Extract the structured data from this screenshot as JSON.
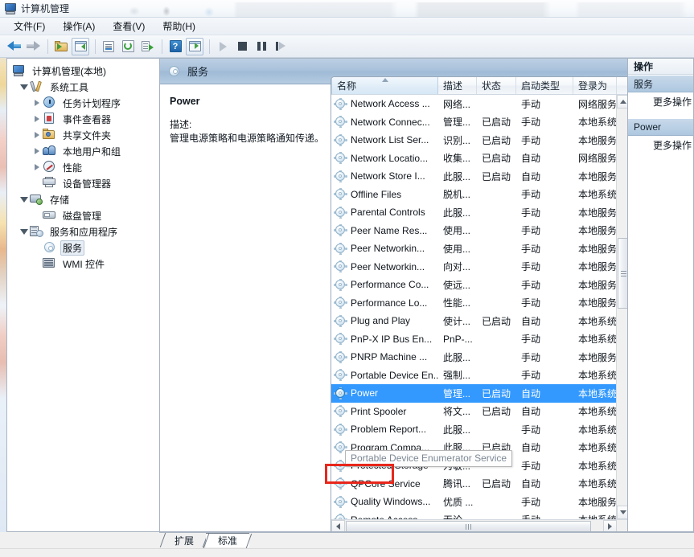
{
  "window": {
    "title": "计算机管理",
    "app_icon": "computer-management-icon"
  },
  "menubar": [
    {
      "label": "文件(F)"
    },
    {
      "label": "操作(A)"
    },
    {
      "label": "查看(V)"
    },
    {
      "label": "帮助(H)"
    }
  ],
  "toolbar": {
    "buttons": [
      {
        "name": "back",
        "icon": "back-arrow-icon"
      },
      {
        "name": "forward",
        "icon": "forward-arrow-icon"
      },
      {
        "name": "up-folder",
        "icon": "folder-up-icon"
      },
      {
        "name": "show-console-tree",
        "icon": "console-tree-icon"
      },
      {
        "name": "properties",
        "icon": "properties-icon"
      },
      {
        "name": "refresh",
        "icon": "refresh-icon"
      },
      {
        "name": "export-list",
        "icon": "export-list-icon"
      },
      {
        "name": "help",
        "icon": "help-icon"
      },
      {
        "name": "show-action-pane",
        "icon": "action-pane-icon"
      },
      {
        "name": "start-service",
        "icon": "play-icon"
      },
      {
        "name": "stop-service",
        "icon": "stop-icon"
      },
      {
        "name": "pause-service",
        "icon": "pause-icon"
      },
      {
        "name": "restart-service",
        "icon": "restart-icon"
      }
    ],
    "help_glyph": "?"
  },
  "tree": {
    "root": {
      "label": "计算机管理(本地)",
      "icon": "computer-icon"
    },
    "items": [
      {
        "label": "系统工具",
        "icon": "tools-icon",
        "indent": 1,
        "expander": "open",
        "selected": false
      },
      {
        "label": "任务计划程序",
        "icon": "clock-icon",
        "indent": 2,
        "expander": "closed",
        "selected": false
      },
      {
        "label": "事件查看器",
        "icon": "event-icon",
        "indent": 2,
        "expander": "closed",
        "selected": false
      },
      {
        "label": "共享文件夹",
        "icon": "share-icon",
        "indent": 2,
        "expander": "closed",
        "selected": false
      },
      {
        "label": "本地用户和组",
        "icon": "users-icon",
        "indent": 2,
        "expander": "closed",
        "selected": false
      },
      {
        "label": "性能",
        "icon": "perf-icon",
        "indent": 2,
        "expander": "closed",
        "selected": false
      },
      {
        "label": "设备管理器",
        "icon": "device-icon",
        "indent": 2,
        "expander": "none",
        "selected": false
      },
      {
        "label": "存储",
        "icon": "storage-icon",
        "indent": 1,
        "expander": "open",
        "selected": false
      },
      {
        "label": "磁盘管理",
        "icon": "disk-icon",
        "indent": 2,
        "expander": "none",
        "selected": false
      },
      {
        "label": "服务和应用程序",
        "icon": "services-app-icon",
        "indent": 1,
        "expander": "open",
        "selected": false
      },
      {
        "label": "服务",
        "icon": "gear-icon",
        "indent": 2,
        "expander": "none",
        "selected": true
      },
      {
        "label": "WMI 控件",
        "icon": "wmi-icon",
        "indent": 2,
        "expander": "none",
        "selected": false
      }
    ]
  },
  "console": {
    "header_title": "服务",
    "header_icon": "gear-icon",
    "detail": {
      "service_name": "Power",
      "desc_label": "描述:",
      "desc_text": "管理电源策略和电源策略通知传递。"
    }
  },
  "list": {
    "columns": [
      {
        "label": "名称",
        "width": 133,
        "sorted": true,
        "sort_dir": "asc"
      },
      {
        "label": "描述",
        "width": 48
      },
      {
        "label": "状态",
        "width": 49
      },
      {
        "label": "启动类型",
        "width": 71
      },
      {
        "label": "登录为",
        "width": 54
      }
    ],
    "rows": [
      {
        "name": "Network Access ...",
        "desc": "网络...",
        "status": "",
        "startup": "手动",
        "logon": "网络服务"
      },
      {
        "name": "Network Connec...",
        "desc": "管理...",
        "status": "已启动",
        "startup": "手动",
        "logon": "本地系统"
      },
      {
        "name": "Network List Ser...",
        "desc": "识别...",
        "status": "已启动",
        "startup": "手动",
        "logon": "本地服务"
      },
      {
        "name": "Network Locatio...",
        "desc": "收集...",
        "status": "已启动",
        "startup": "自动",
        "logon": "网络服务"
      },
      {
        "name": "Network Store I...",
        "desc": "此服...",
        "status": "已启动",
        "startup": "自动",
        "logon": "本地服务"
      },
      {
        "name": "Offline Files",
        "desc": "脱机...",
        "status": "",
        "startup": "手动",
        "logon": "本地系统"
      },
      {
        "name": "Parental Controls",
        "desc": "此服...",
        "status": "",
        "startup": "手动",
        "logon": "本地服务"
      },
      {
        "name": "Peer Name Res...",
        "desc": "使用...",
        "status": "",
        "startup": "手动",
        "logon": "本地服务"
      },
      {
        "name": "Peer Networkin...",
        "desc": "使用...",
        "status": "",
        "startup": "手动",
        "logon": "本地服务"
      },
      {
        "name": "Peer Networkin...",
        "desc": "向对...",
        "status": "",
        "startup": "手动",
        "logon": "本地服务"
      },
      {
        "name": "Performance Co...",
        "desc": "使远...",
        "status": "",
        "startup": "手动",
        "logon": "本地服务"
      },
      {
        "name": "Performance Lo...",
        "desc": "性能...",
        "status": "",
        "startup": "手动",
        "logon": "本地服务"
      },
      {
        "name": "Plug and Play",
        "desc": "使计...",
        "status": "已启动",
        "startup": "自动",
        "logon": "本地系统"
      },
      {
        "name": "PnP-X IP Bus En...",
        "desc": "PnP-...",
        "status": "",
        "startup": "手动",
        "logon": "本地系统"
      },
      {
        "name": "PNRP Machine ...",
        "desc": "此服...",
        "status": "",
        "startup": "手动",
        "logon": "本地服务"
      },
      {
        "name": "Portable Device En...",
        "desc": "强制...",
        "status": "",
        "startup": "手动",
        "logon": "本地系统"
      },
      {
        "name": "Power",
        "desc": "管理...",
        "status": "已启动",
        "startup": "自动",
        "logon": "本地系统",
        "selected": true
      },
      {
        "name": "Print Spooler",
        "desc": "将文...",
        "status": "已启动",
        "startup": "自动",
        "logon": "本地系统"
      },
      {
        "name": "Problem Report...",
        "desc": "此服...",
        "status": "",
        "startup": "手动",
        "logon": "本地系统"
      },
      {
        "name": "Program Compa...",
        "desc": "此服...",
        "status": "已启动",
        "startup": "自动",
        "logon": "本地系统"
      },
      {
        "name": "Protected Storage",
        "desc": "为敏...",
        "status": "",
        "startup": "手动",
        "logon": "本地系统"
      },
      {
        "name": "QPCore Service",
        "desc": "腾讯...",
        "status": "已启动",
        "startup": "自动",
        "logon": "本地系统"
      },
      {
        "name": "Quality Windows...",
        "desc": "优质 ...",
        "status": "",
        "startup": "手动",
        "logon": "本地服务"
      },
      {
        "name": "Remote Access ...",
        "desc": "无论...",
        "status": "",
        "startup": "手动",
        "logon": "本地系统"
      }
    ],
    "tooltip": "Portable Device Enumerator Service"
  },
  "actions": {
    "title": "操作",
    "groups": [
      {
        "label": "服务",
        "items": [
          {
            "label": "更多操作"
          }
        ]
      },
      {
        "label": "Power",
        "items": [
          {
            "label": "更多操作"
          }
        ]
      }
    ]
  },
  "tabs": [
    {
      "label": "扩展",
      "active": false
    },
    {
      "label": "标准",
      "active": true
    }
  ],
  "colors": {
    "selection": "#3399ff",
    "highlight_box": "#e8271c",
    "console_header": "#a8c1da",
    "action_group": "#aec8e0"
  }
}
